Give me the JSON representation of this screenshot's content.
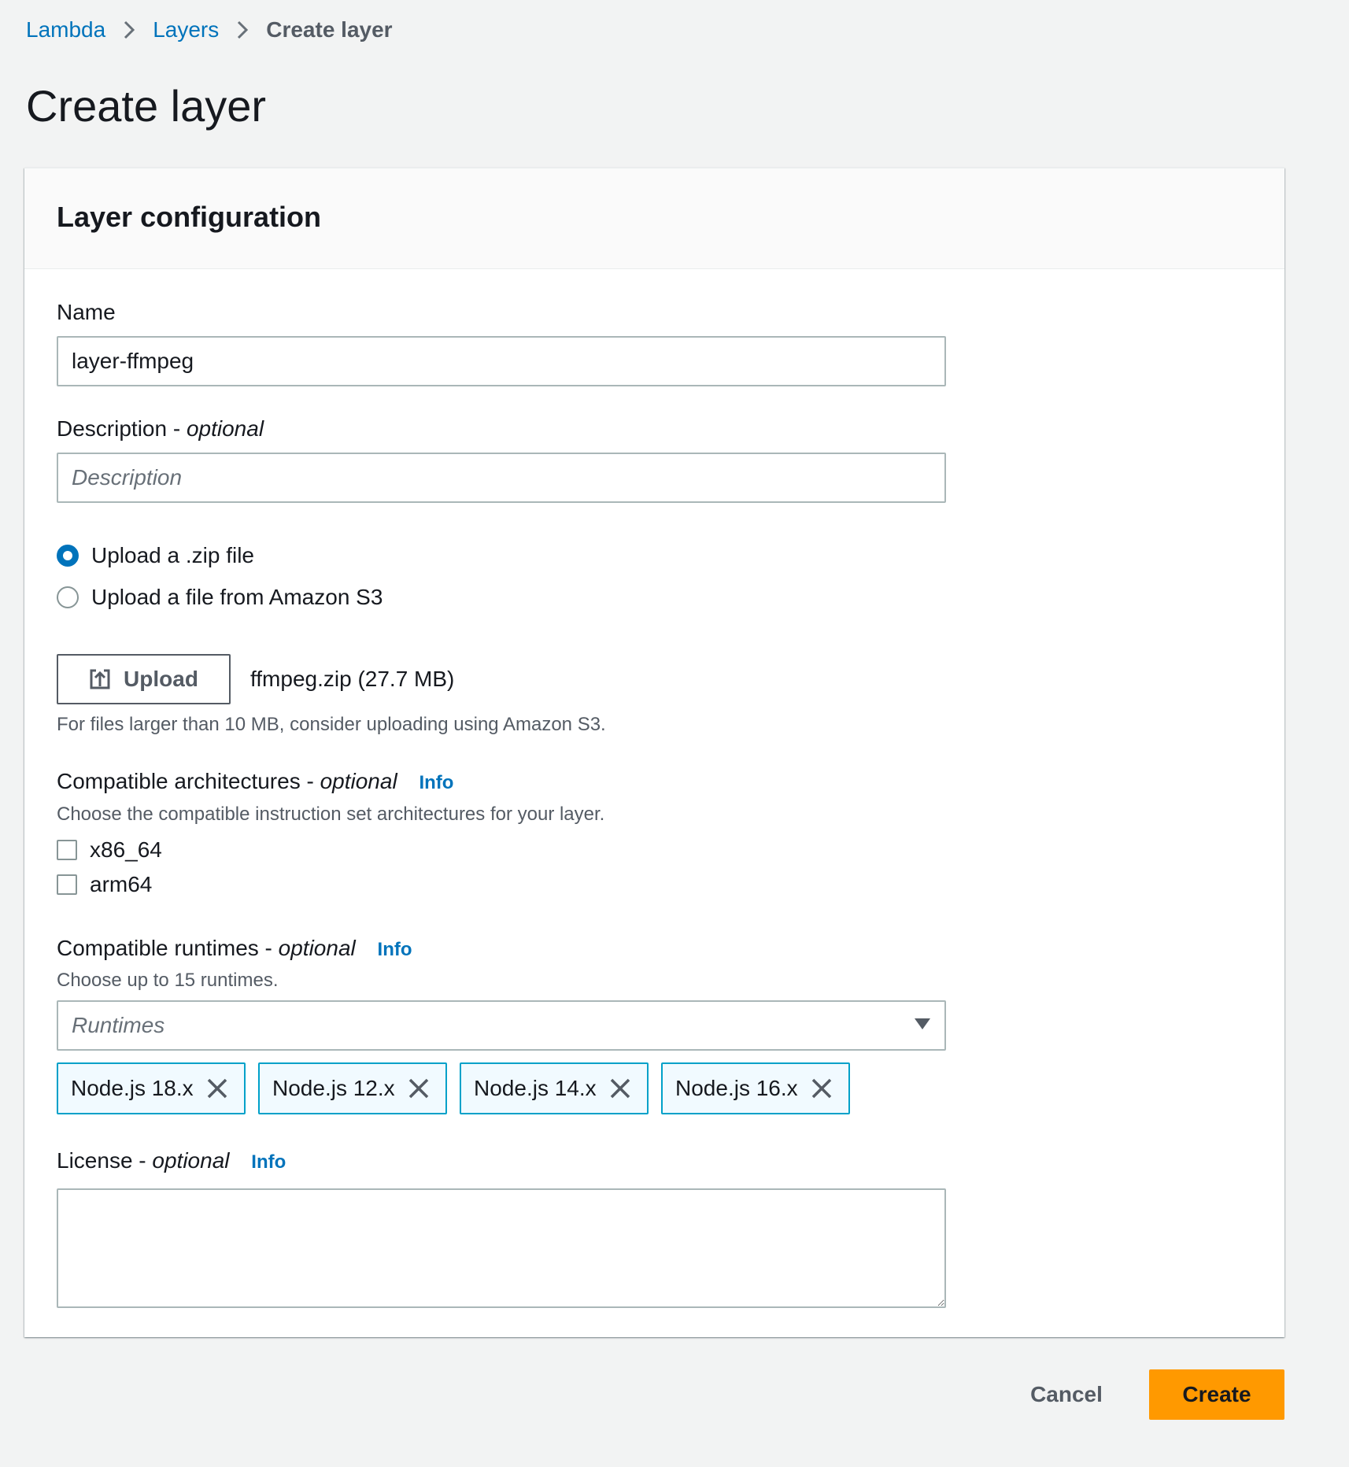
{
  "breadcrumb": {
    "items": [
      {
        "label": "Lambda"
      },
      {
        "label": "Layers"
      },
      {
        "label": "Create layer"
      }
    ]
  },
  "page": {
    "title": "Create layer"
  },
  "card": {
    "title": "Layer configuration"
  },
  "name_field": {
    "label": "Name",
    "value": "layer-ffmpeg"
  },
  "description_field": {
    "label": "Description -",
    "optional": "optional",
    "placeholder": "Description"
  },
  "upload_options": {
    "zip_label": "Upload a .zip file",
    "s3_label": "Upload a file from Amazon S3",
    "selected": "zip"
  },
  "upload": {
    "button_label": "Upload",
    "file_name": "ffmpeg.zip (27.7 MB)",
    "hint": "For files larger than 10 MB, consider uploading using Amazon S3."
  },
  "architectures": {
    "label": "Compatible architectures -",
    "optional": "optional",
    "info": "Info",
    "hint": "Choose the compatible instruction set architectures for your layer.",
    "options": [
      {
        "label": "x86_64",
        "checked": false
      },
      {
        "label": "arm64",
        "checked": false
      }
    ]
  },
  "runtimes": {
    "label": "Compatible runtimes -",
    "optional": "optional",
    "info": "Info",
    "hint": "Choose up to 15 runtimes.",
    "placeholder": "Runtimes",
    "selected": [
      {
        "label": "Node.js 18.x"
      },
      {
        "label": "Node.js 12.x"
      },
      {
        "label": "Node.js 14.x"
      },
      {
        "label": "Node.js 16.x"
      }
    ]
  },
  "license": {
    "label": "License -",
    "optional": "optional",
    "info": "Info",
    "value": ""
  },
  "actions": {
    "cancel_label": "Cancel",
    "create_label": "Create"
  },
  "colors": {
    "link": "#0073bb",
    "primary_button": "#ff9900",
    "token_border": "#00a1c9",
    "token_background": "#f1faff",
    "page_background": "#f2f3f3"
  },
  "icons": {
    "breadcrumb_separator": "chevron-right-icon",
    "upload": "upload-icon",
    "token_remove": "close-icon",
    "select_caret": "caret-down-icon"
  }
}
